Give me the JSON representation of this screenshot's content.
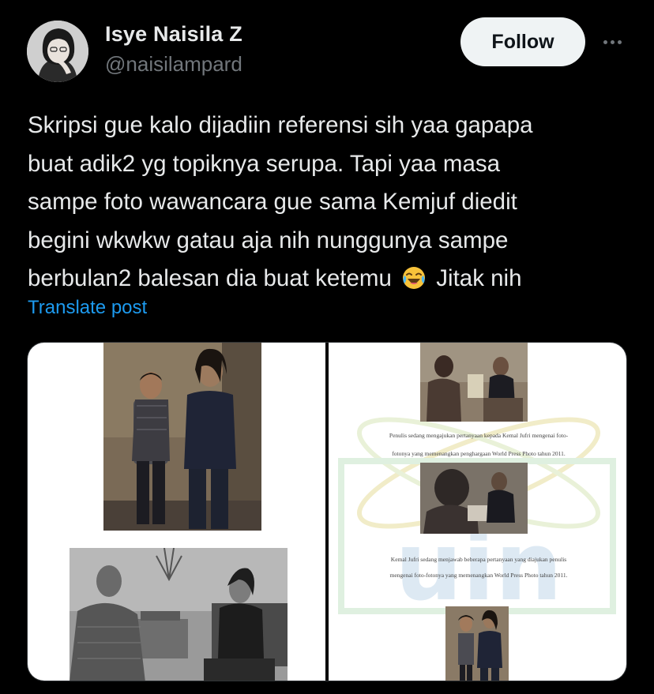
{
  "author": {
    "name": "Isye Naisila Z",
    "handle": "@naisilampard"
  },
  "actions": {
    "follow_label": "Follow",
    "more_icon": "more-horizontal-icon"
  },
  "post": {
    "lines": [
      "Skripsi gue kalo dijadiin referensi sih yaa gapapa",
      "buat adik2 yg topiknya serupa. Tapi yaa masa",
      "sampe foto wawancara gue sama Kemjuf diedit",
      "begini wkwkw gatau aja nih nunggunya sampe",
      "berbulan2 balesan dia buat ketemu",
      "Jitak nih"
    ],
    "emoji": "face-with-tears-of-joy-icon",
    "translate_label": "Translate post"
  },
  "media": {
    "right_captions": [
      "Penulis sedang mengajukan pertanyaan kepada Kemal Jufri mengenai foto-",
      "fotonya yang memenangkan penghargaan World Press Photo tahun 2011.",
      "Kemal Jufri sedang menjawab beberapa pertanyaan yang diajukan penulis",
      "mengenai foto-fotonya yang memenangkan World Press Photo tahun 2011."
    ]
  },
  "colors": {
    "background": "#000000",
    "text": "#e7e9ea",
    "secondary_text": "#71767b",
    "link": "#1d9bf0",
    "button_bg": "#eff3f4"
  }
}
